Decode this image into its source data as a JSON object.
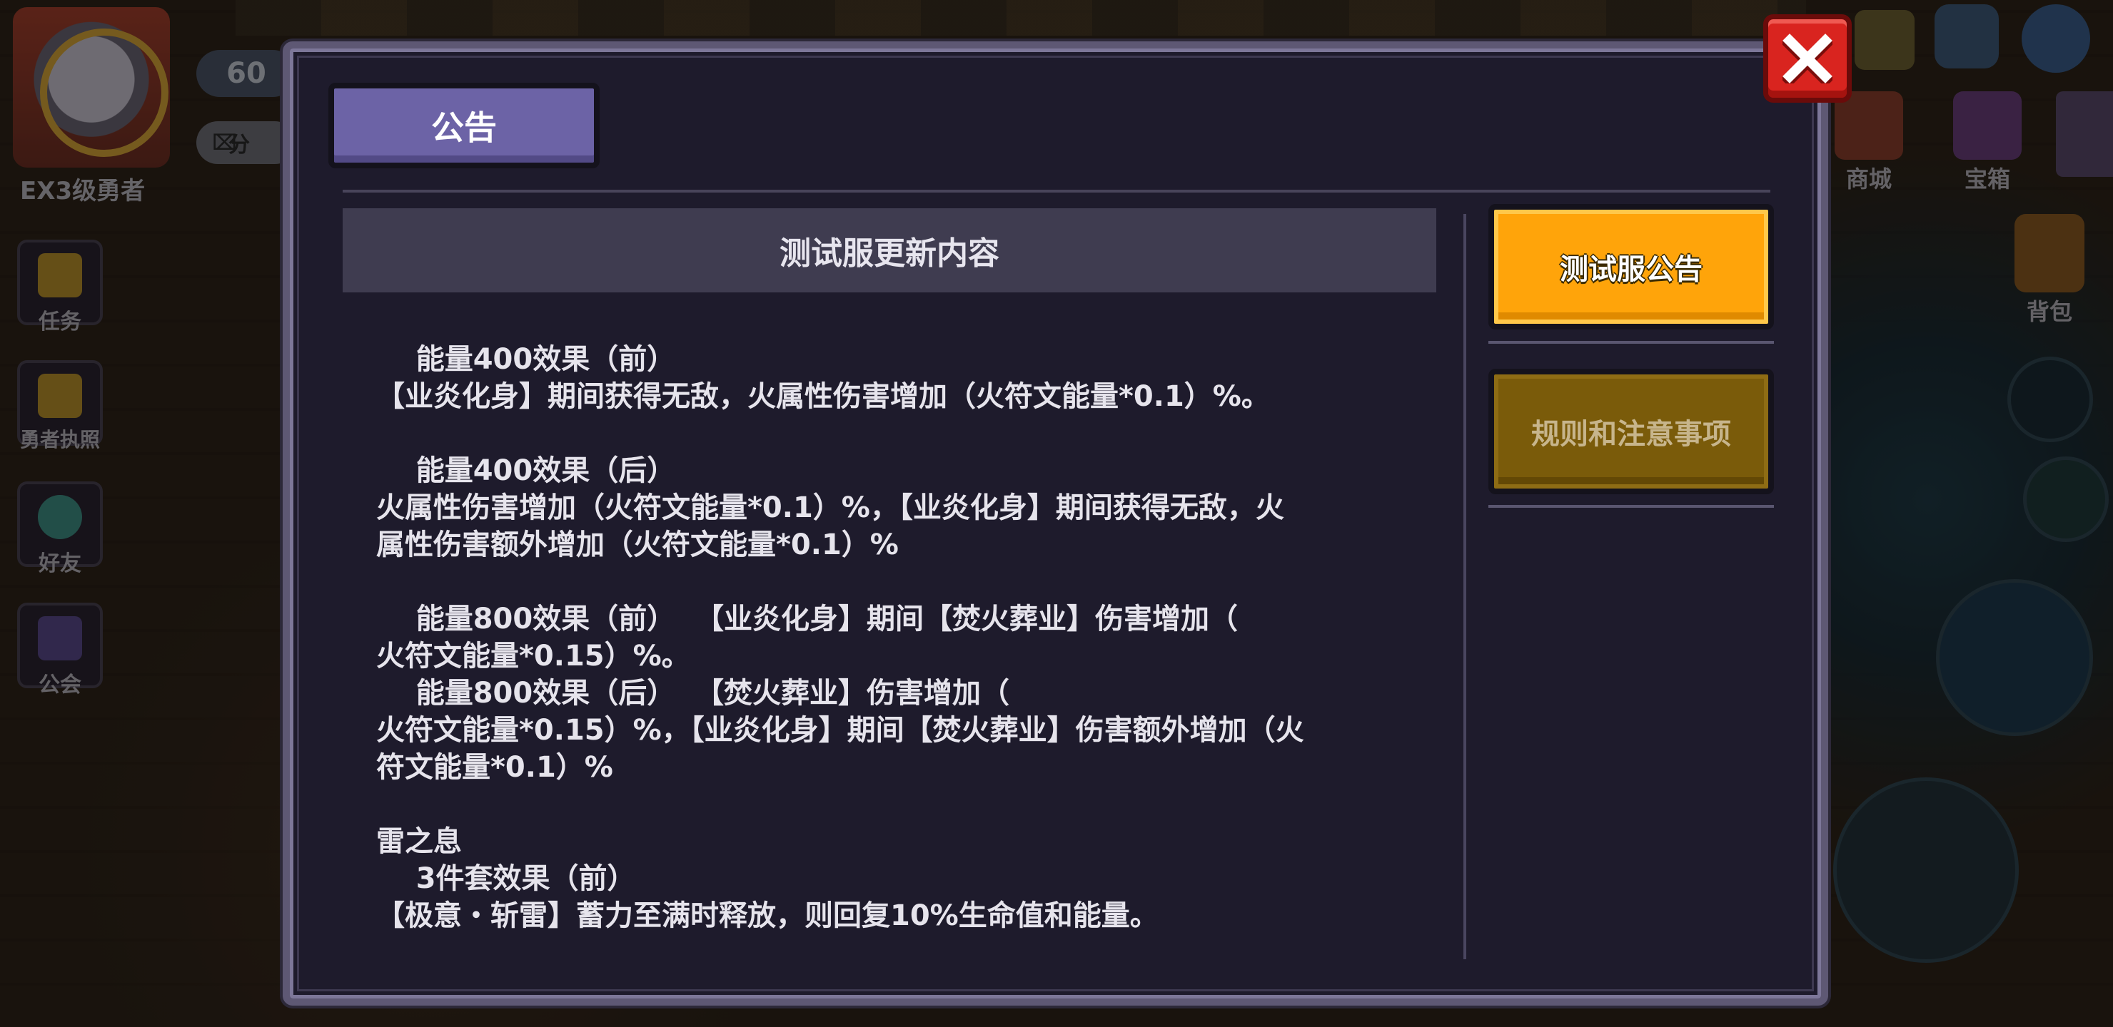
{
  "hud": {
    "player_rank": "EX3级勇者",
    "level": "60",
    "score_label": "分",
    "side_menu": [
      {
        "label": "任务",
        "icon": "quest-icon"
      },
      {
        "label": "勇者执照",
        "icon": "license-icon"
      },
      {
        "label": "好友",
        "icon": "friends-icon"
      },
      {
        "label": "公会",
        "icon": "guild-icon"
      }
    ],
    "right_menu": {
      "shop": "商城",
      "chest": "宝箱",
      "bag": "背包"
    }
  },
  "dialog": {
    "tab_title": "公告",
    "content_title": "测试服更新内容",
    "side_tabs": {
      "active": "测试服公告",
      "inactive": "规则和注意事项"
    },
    "content_lines": [
      "    能量400效果（前）",
      "【业炎化身】期间获得无敌，火属性伤害增加（火符文能量*0.1）%。",
      "",
      "    能量400效果（后）",
      "火属性伤害增加（火符文能量*0.1）%，【业炎化身】期间获得无敌，火",
      "属性伤害额外增加（火符文能量*0.1）%",
      "",
      "    能量800效果（前）  【业炎化身】期间【焚火葬业】伤害增加（",
      "火符文能量*0.15）%。",
      "    能量800效果（后）  【焚火葬业】伤害增加（",
      "火符文能量*0.15）%，【业炎化身】期间【焚火葬业】伤害额外增加（火",
      "符文能量*0.1）%",
      "",
      "雷之息",
      "    3件套效果（前）",
      "【极意・斩雷】蓄力至满时释放，则回复10%生命值和能量。"
    ]
  },
  "colors": {
    "dialog_bg": "#1e1b2c",
    "tab_purple": "#6c63a6",
    "active_orange": "#ffa40a",
    "inactive_brown": "#7a5b0a",
    "close_red": "#d9241f"
  }
}
